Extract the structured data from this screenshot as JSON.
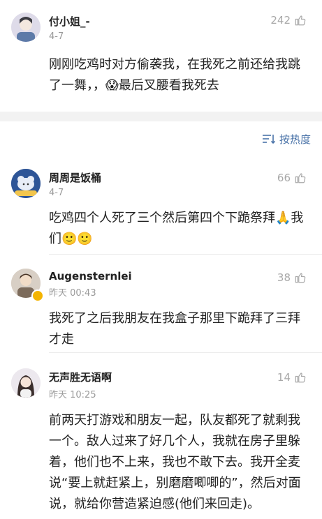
{
  "comments_top": [
    {
      "user": "付小姐_-",
      "time": "4-7",
      "likes": "242",
      "text": "刚刚吃鸡时对方偷袭我，在我死之前还给我跳了一舞，，😱最后叉腰看我死去"
    }
  ],
  "sort": {
    "label": "按热度",
    "icon": "sort-lines-icon",
    "accent": "#4a73a8"
  },
  "comments": [
    {
      "user": "周周是饭桶",
      "time": "4-7",
      "likes": "66",
      "text": "吃鸡四个人死了三个然后第四个下跪祭拜🙏我们🙂🙂"
    },
    {
      "user": "Augensternlei",
      "time": "昨天 00:43",
      "likes": "38",
      "text": "我死了之后我朋友在我盒子那里下跪拜了三拜才走"
    },
    {
      "user": "无声胜无语啊",
      "time": "昨天 10:25",
      "likes": "14",
      "text": "前两天打游戏和朋友一起，队友都死了就剩我一个。敌人过来了好几个人，我就在房子里躲着，他们也不上来，我也不敢下去。我开全麦说“要上就赶紧上，别磨磨唧唧的”，然后对面说，就给你营造紧迫感(他们来回走)。"
    }
  ],
  "icons": {
    "like": "thumbs-up-icon"
  }
}
